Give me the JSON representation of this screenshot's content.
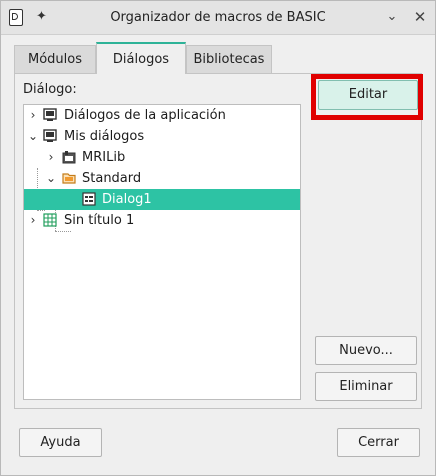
{
  "window": {
    "title": "Organizador de macros de BASIC"
  },
  "tabs": [
    {
      "label": "Módulos",
      "active": false
    },
    {
      "label": "Diálogos",
      "active": true
    },
    {
      "label": "Bibliotecas",
      "active": false
    }
  ],
  "panel": {
    "dialog_label": "Diálogo:",
    "tree": [
      {
        "label": "Diálogos de la aplicación",
        "level": 0,
        "expanded": false,
        "icon": "container-icon"
      },
      {
        "label": "Mis diálogos",
        "level": 0,
        "expanded": true,
        "icon": "container-icon"
      },
      {
        "label": "MRILib",
        "level": 1,
        "expanded": false,
        "icon": "library-icon"
      },
      {
        "label": "Standard",
        "level": 1,
        "expanded": true,
        "icon": "folder-icon"
      },
      {
        "label": "Dialog1",
        "level": 2,
        "selected": true,
        "icon": "dialog-icon"
      },
      {
        "label": "Sin título 1",
        "level": 0,
        "expanded": false,
        "icon": "spreadsheet-icon"
      }
    ]
  },
  "buttons": {
    "editar": "Editar",
    "nuevo": "Nuevo...",
    "eliminar": "Eliminar",
    "ayuda": "Ayuda",
    "cerrar": "Cerrar"
  },
  "colors": {
    "selection": "#2dc3a4",
    "accent_tab": "#2eb398",
    "highlight_box": "#e00000"
  }
}
